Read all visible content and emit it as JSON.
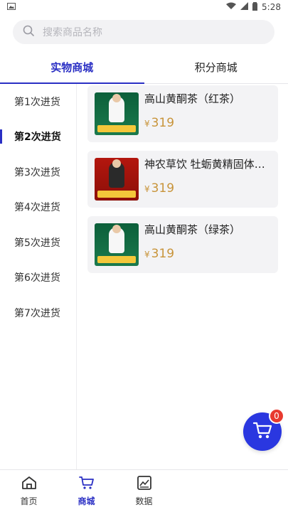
{
  "status_bar": {
    "time": "5:28"
  },
  "search": {
    "placeholder": "搜索商品名称"
  },
  "tabs": [
    {
      "label": "实物商城"
    },
    {
      "label": "积分商城"
    }
  ],
  "sidebar": {
    "items": [
      {
        "label": "第1次进货"
      },
      {
        "label": "第2次进货"
      },
      {
        "label": "第3次进货"
      },
      {
        "label": "第4次进货"
      },
      {
        "label": "第5次进货"
      },
      {
        "label": "第6次进货"
      },
      {
        "label": "第7次进货"
      }
    ]
  },
  "products": [
    {
      "name": "高山黄酮茶（红茶）",
      "currency": "¥",
      "price": "319"
    },
    {
      "name": "神农草饮 牡蛎黄精固体饮...",
      "currency": "¥",
      "price": "319"
    },
    {
      "name": "高山黄酮茶（绿茶）",
      "currency": "¥",
      "price": "319"
    }
  ],
  "cart": {
    "count": "0"
  },
  "bottom_nav": [
    {
      "label": "首页"
    },
    {
      "label": "商城"
    },
    {
      "label": "数据"
    }
  ],
  "colors": {
    "accent": "#2a2fc4",
    "price": "#c8943a",
    "badge": "#e83a2f"
  }
}
